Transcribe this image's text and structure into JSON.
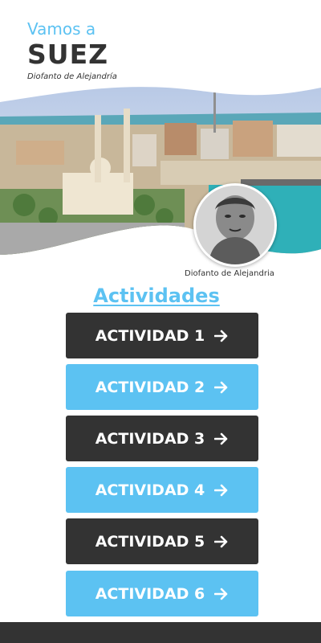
{
  "header": {
    "kicker": "Vamos a",
    "title": "SUEZ",
    "byline": "Diofanto de Alejandría"
  },
  "portrait": {
    "caption": "Diofanto de Alejandria"
  },
  "section": {
    "title": "Actividades"
  },
  "activities": [
    {
      "label": "ACTIVIDAD 1",
      "icon": "arrow-right-icon"
    },
    {
      "label": "ACTIVIDAD 2",
      "icon": "arrow-right-icon"
    },
    {
      "label": "ACTIVIDAD 3",
      "icon": "arrow-right-icon"
    },
    {
      "label": "ACTIVIDAD 4",
      "icon": "arrow-right-icon"
    },
    {
      "label": "ACTIVIDAD 5",
      "icon": "arrow-right-icon"
    },
    {
      "label": "ACTIVIDAD 6",
      "icon": "arrow-right-icon"
    }
  ],
  "colors": {
    "accent": "#5cc2f2",
    "dark": "#333333"
  }
}
